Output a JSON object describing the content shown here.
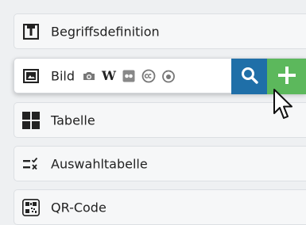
{
  "items": [
    {
      "label": "Begriffsdefinition",
      "icon": "definition-book-icon"
    },
    {
      "label": "Bild",
      "icon": "image-icon"
    },
    {
      "label": "Tabelle",
      "icon": "table-grid-icon"
    },
    {
      "label": "Auswahltabelle",
      "icon": "choice-table-icon"
    },
    {
      "label": "QR-Code",
      "icon": "qr-code-icon"
    }
  ],
  "image_sources": [
    "camera-icon",
    "wikipedia-icon",
    "flickr-icon",
    "creative-commons-icon",
    "pixabay-icon"
  ],
  "wikipedia_glyph": "W",
  "actions": {
    "search": "search-icon",
    "add": "plus-icon"
  },
  "colors": {
    "search": "#1f6fa8",
    "add": "#5cb85c",
    "background": "#eef0f2"
  }
}
